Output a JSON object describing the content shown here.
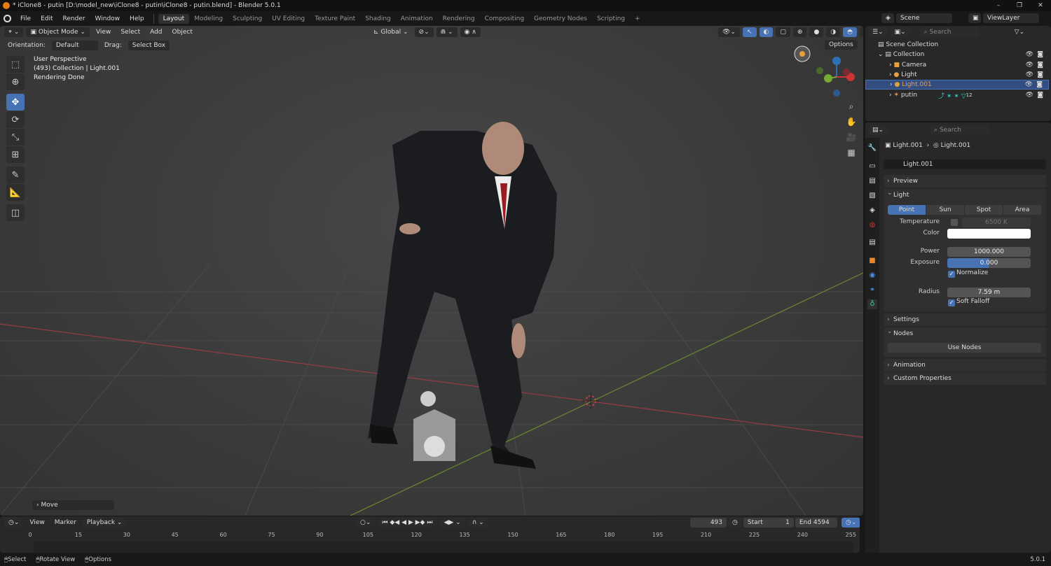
{
  "window": {
    "title": "* iClone8 - putin [D:\\model_new\\iClone8 - putin\\iClone8 - putin.blend] - Blender 5.0.1",
    "min": "–",
    "max": "❐",
    "close": "✕"
  },
  "menu": [
    "File",
    "Edit",
    "Render",
    "Window",
    "Help"
  ],
  "workspaces": [
    "Layout",
    "Modeling",
    "Sculpting",
    "UV Editing",
    "Texture Paint",
    "Shading",
    "Animation",
    "Rendering",
    "Compositing",
    "Geometry Nodes",
    "Scripting",
    "+"
  ],
  "active_workspace": "Layout",
  "scene": {
    "name": "Scene",
    "view_layer": "ViewLayer"
  },
  "viewport": {
    "mode": "Object Mode",
    "menus": [
      "View",
      "Select",
      "Add",
      "Object"
    ],
    "transform_orientation": "Global",
    "orientation_label": "Orientation:",
    "orientation_value": "Default",
    "drag_label": "Drag:",
    "drag_value": "Select Box",
    "options": "Options",
    "info": [
      "User Perspective",
      "(493) Collection | Light.001",
      "Rendering Done"
    ],
    "last_operator": "Move",
    "gizmo": {
      "z": "Z",
      "x": "X",
      "y": "Y"
    },
    "accent": "#4772b3"
  },
  "outliner": {
    "search_placeholder": "Search",
    "root": "Scene Collection",
    "collection": "Collection",
    "items": [
      {
        "name": "Camera",
        "icon": "camera-icon"
      },
      {
        "name": "Light",
        "icon": "light-icon"
      },
      {
        "name": "Light.001",
        "icon": "light-icon",
        "selected": true
      },
      {
        "name": "putin",
        "icon": "armature-icon",
        "badge": "12"
      }
    ]
  },
  "properties": {
    "search_placeholder": "Search",
    "breadcrumb": [
      "Light.001",
      "Light.001"
    ],
    "datablock": "Light.001",
    "panels": {
      "preview": "Preview",
      "light": "Light",
      "settings": "Settings",
      "nodes": "Nodes",
      "animation": "Animation",
      "custom": "Custom Properties"
    },
    "light_types": [
      "Point",
      "Sun",
      "Spot",
      "Area"
    ],
    "active_type": "Point",
    "temperature_label": "Temperature",
    "temperature": "6500 K",
    "color_label": "Color",
    "color": "#ffffff",
    "power_label": "Power",
    "power": "1000.000",
    "exposure_label": "Exposure",
    "exposure": "0.000",
    "normalize": "Normalize",
    "radius_label": "Radius",
    "radius": "7.59 m",
    "soft_falloff": "Soft Falloff",
    "use_nodes": "Use Nodes"
  },
  "timeline": {
    "menus": [
      "View",
      "Marker",
      "Playback"
    ],
    "current_frame": "493",
    "start_label": "Start",
    "start": "1",
    "end_label": "End",
    "end": "4594",
    "ticks": [
      "0",
      "15",
      "30",
      "45",
      "60",
      "75",
      "90",
      "105",
      "120",
      "135",
      "150",
      "165",
      "180",
      "195",
      "210",
      "225",
      "240",
      "255"
    ]
  },
  "status": {
    "items": [
      "Select",
      "Rotate View",
      "Options"
    ],
    "version": "5.0.1"
  }
}
